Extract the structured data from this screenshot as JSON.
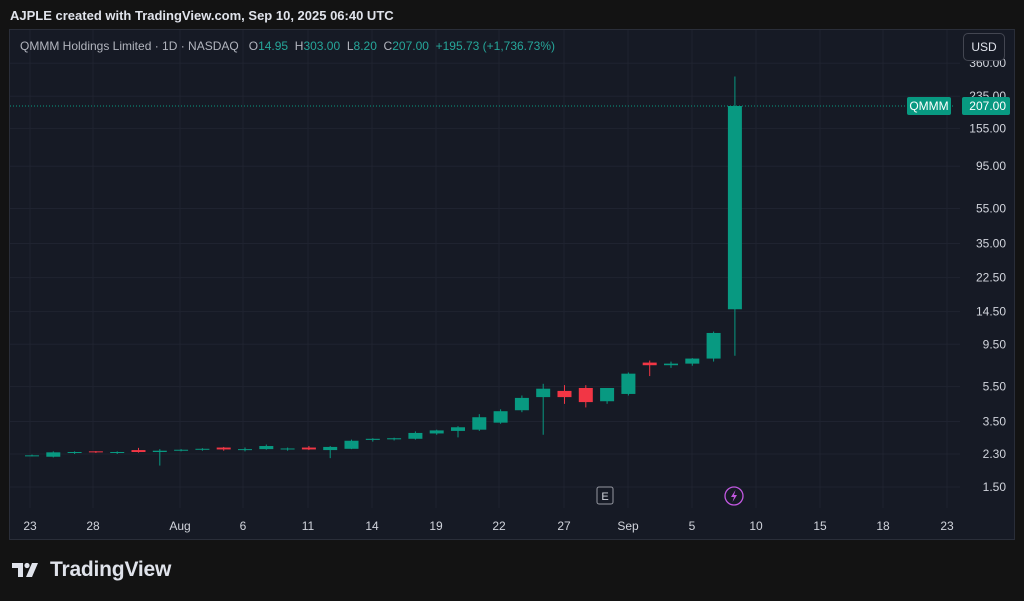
{
  "header": {
    "credit": "AJPLE created with TradingView.com, Sep 10, 2025 06:40 UTC"
  },
  "legend": {
    "symbol": "QMMM Holdings Limited · 1D · NASDAQ",
    "o_label": "O",
    "o_value": "14.95",
    "h_label": "H",
    "h_value": "303.00",
    "l_label": "L",
    "l_value": "8.20",
    "c_label": "C",
    "c_value": "207.00",
    "change": "+195.73 (+1,736.73%)"
  },
  "currency_button": "USD",
  "price_tag": {
    "ticker": "QMMM",
    "value": "207.00"
  },
  "markers": {
    "earnings": "E",
    "dividend_icon": "lightning-icon"
  },
  "colors": {
    "up": "#089981",
    "down": "#f23645",
    "background": "#161a25"
  },
  "footer": {
    "brand": "TradingView",
    "logo_icon": "tradingview-logo-icon"
  },
  "chart_data": {
    "type": "candlestick",
    "title": "QMMM Holdings Limited · 1D · NASDAQ",
    "y_scale": "log",
    "y_ticks": [
      "360.00",
      "235.00",
      "155.00",
      "95.00",
      "55.00",
      "35.00",
      "22.50",
      "14.50",
      "9.50",
      "5.50",
      "3.50",
      "2.30",
      "1.50"
    ],
    "y_tick_values": [
      360,
      235,
      155,
      95,
      55,
      35,
      22.5,
      14.5,
      9.5,
      5.5,
      3.5,
      2.3,
      1.5
    ],
    "x_ticks": [
      "23",
      "28",
      "Aug",
      "6",
      "11",
      "14",
      "19",
      "22",
      "27",
      "Sep",
      "5",
      "10",
      "15",
      "18",
      "23"
    ],
    "last_price": 207.0,
    "candles": [
      {
        "date": "Jul 22",
        "o": 2.25,
        "h": 2.28,
        "l": 2.23,
        "c": 2.26
      },
      {
        "date": "Jul 23",
        "o": 2.22,
        "h": 2.38,
        "l": 2.2,
        "c": 2.35
      },
      {
        "date": "Jul 24",
        "o": 2.33,
        "h": 2.38,
        "l": 2.3,
        "c": 2.36
      },
      {
        "date": "Jul 25",
        "o": 2.38,
        "h": 2.39,
        "l": 2.33,
        "c": 2.35
      },
      {
        "date": "Jul 28",
        "o": 2.33,
        "h": 2.38,
        "l": 2.3,
        "c": 2.36
      },
      {
        "date": "Jul 29",
        "o": 2.42,
        "h": 2.49,
        "l": 2.34,
        "c": 2.36
      },
      {
        "date": "Jul 30",
        "o": 2.36,
        "h": 2.45,
        "l": 1.98,
        "c": 2.4
      },
      {
        "date": "Jul 31",
        "o": 2.4,
        "h": 2.45,
        "l": 2.38,
        "c": 2.43
      },
      {
        "date": "Aug 1",
        "o": 2.43,
        "h": 2.48,
        "l": 2.4,
        "c": 2.46
      },
      {
        "date": "Aug 4",
        "o": 2.5,
        "h": 2.52,
        "l": 2.4,
        "c": 2.44
      },
      {
        "date": "Aug 5",
        "o": 2.42,
        "h": 2.5,
        "l": 2.38,
        "c": 2.45
      },
      {
        "date": "Aug 6",
        "o": 2.45,
        "h": 2.6,
        "l": 2.43,
        "c": 2.55
      },
      {
        "date": "Aug 7",
        "o": 2.45,
        "h": 2.5,
        "l": 2.4,
        "c": 2.47
      },
      {
        "date": "Aug 8",
        "o": 2.5,
        "h": 2.55,
        "l": 2.42,
        "c": 2.44
      },
      {
        "date": "Aug 11",
        "o": 2.42,
        "h": 2.55,
        "l": 2.18,
        "c": 2.52
      },
      {
        "date": "Aug 12",
        "o": 2.46,
        "h": 2.77,
        "l": 2.45,
        "c": 2.73
      },
      {
        "date": "Aug 13",
        "o": 2.76,
        "h": 2.82,
        "l": 2.7,
        "c": 2.8
      },
      {
        "date": "Aug 14",
        "o": 2.78,
        "h": 2.84,
        "l": 2.74,
        "c": 2.82
      },
      {
        "date": "Aug 15",
        "o": 2.8,
        "h": 3.08,
        "l": 2.77,
        "c": 3.02
      },
      {
        "date": "Aug 18",
        "o": 3.0,
        "h": 3.15,
        "l": 2.95,
        "c": 3.12
      },
      {
        "date": "Aug 19",
        "o": 3.1,
        "h": 3.3,
        "l": 2.85,
        "c": 3.25
      },
      {
        "date": "Aug 20",
        "o": 3.15,
        "h": 3.85,
        "l": 3.1,
        "c": 3.7
      },
      {
        "date": "Aug 21",
        "o": 3.45,
        "h": 4.1,
        "l": 3.4,
        "c": 4.0
      },
      {
        "date": "Aug 22",
        "o": 4.05,
        "h": 4.9,
        "l": 3.95,
        "c": 4.75
      },
      {
        "date": "Aug 25",
        "o": 4.8,
        "h": 5.7,
        "l": 2.95,
        "c": 5.35
      },
      {
        "date": "Aug 26",
        "o": 5.2,
        "h": 5.6,
        "l": 4.4,
        "c": 4.8
      },
      {
        "date": "Aug 27",
        "o": 5.4,
        "h": 5.6,
        "l": 4.2,
        "c": 4.5
      },
      {
        "date": "Aug 29",
        "o": 4.55,
        "h": 5.4,
        "l": 4.4,
        "c": 5.4
      },
      {
        "date": "Sep 2",
        "o": 5.0,
        "h": 6.6,
        "l": 4.9,
        "c": 6.5
      },
      {
        "date": "Sep 3",
        "o": 7.5,
        "h": 7.7,
        "l": 6.3,
        "c": 7.25
      },
      {
        "date": "Sep 4",
        "o": 7.25,
        "h": 7.6,
        "l": 7.0,
        "c": 7.4
      },
      {
        "date": "Sep 5",
        "o": 7.4,
        "h": 7.95,
        "l": 7.2,
        "c": 7.9
      },
      {
        "date": "Sep 8",
        "o": 7.9,
        "h": 11.2,
        "l": 7.6,
        "c": 11.0
      },
      {
        "date": "Sep 9",
        "o": 14.95,
        "h": 303.0,
        "l": 8.2,
        "c": 207.0
      }
    ]
  }
}
